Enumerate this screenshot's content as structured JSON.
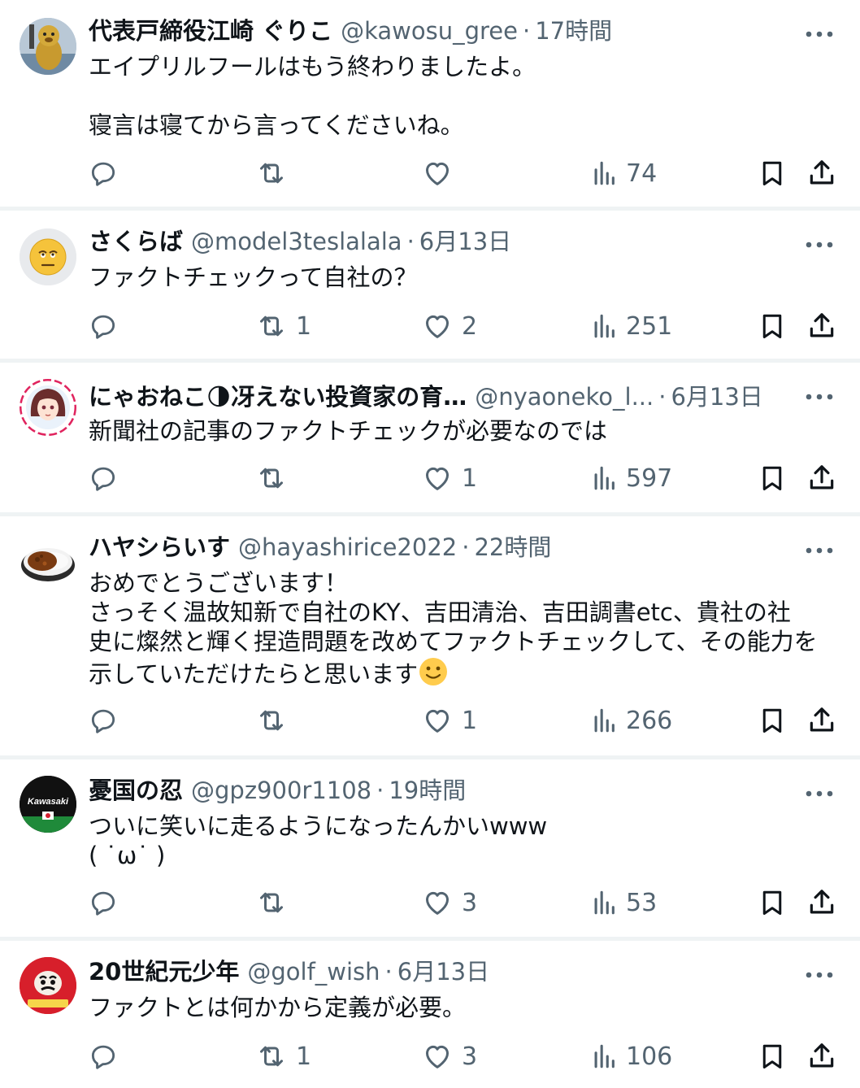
{
  "tweets": [
    {
      "name": "代表戸締役江崎 ぐりこ",
      "handle": "@kawosu_gree",
      "sep": "·",
      "time": "17時間",
      "body": "エイプリルフールはもう終わりましたよ。\n\n寝言は寝てから言ってくださいね。",
      "replies": "",
      "retweets": "",
      "likes": "",
      "views": "74",
      "avatar": "mascot-avatar"
    },
    {
      "name": "さくらば",
      "handle": "@model3teslalala",
      "sep": "·",
      "time": "6月13日",
      "body": "ファクトチェックって自社の？",
      "replies": "",
      "retweets": "1",
      "likes": "2",
      "views": "251",
      "avatar": "face-emoji-avatar"
    },
    {
      "name": "にゃおねこ🌗冴えない投資家の育…",
      "handle": "@nyaoneko_l...",
      "sep": "·",
      "time": "6月13日",
      "body": "新聞社の記事のファクトチェックが必要なのでは",
      "replies": "",
      "retweets": "",
      "likes": "1",
      "views": "597",
      "avatar": "anime-girl-avatar"
    },
    {
      "name": "ハヤシらいす",
      "handle": "@hayashirice2022",
      "sep": "·",
      "time": "22時間",
      "body": "おめでとうございます！\nさっそく温故知新で自社のKY、吉田清治、吉田調書etc、貴社の社\n史に燦然と輝く捏造問題を改めてファクトチェックして、その能力を\n示していただけたらと思います",
      "replies": "",
      "retweets": "",
      "likes": "1",
      "views": "266",
      "avatar": "curry-rice-avatar"
    },
    {
      "name": "憂国の忍",
      "handle": "@gpz900r1108",
      "sep": "·",
      "time": "19時間",
      "body": "ついに笑いに走るようになったんかいwww\n( ˙ω˙ )",
      "replies": "",
      "retweets": "",
      "likes": "3",
      "views": "53",
      "avatar": "kawasaki-avatar",
      "avatar_text": "Kawasaki"
    },
    {
      "name": "20世紀元少年",
      "handle": "@golf_wish",
      "sep": "·",
      "time": "6月13日",
      "body": "ファクトとは何かから定義が必要。",
      "replies": "",
      "retweets": "1",
      "likes": "3",
      "views": "106",
      "avatar": "daruma-avatar"
    }
  ],
  "colors": {
    "text": "#0f1419",
    "muted": "#536471",
    "divider": "#eff3f4"
  }
}
